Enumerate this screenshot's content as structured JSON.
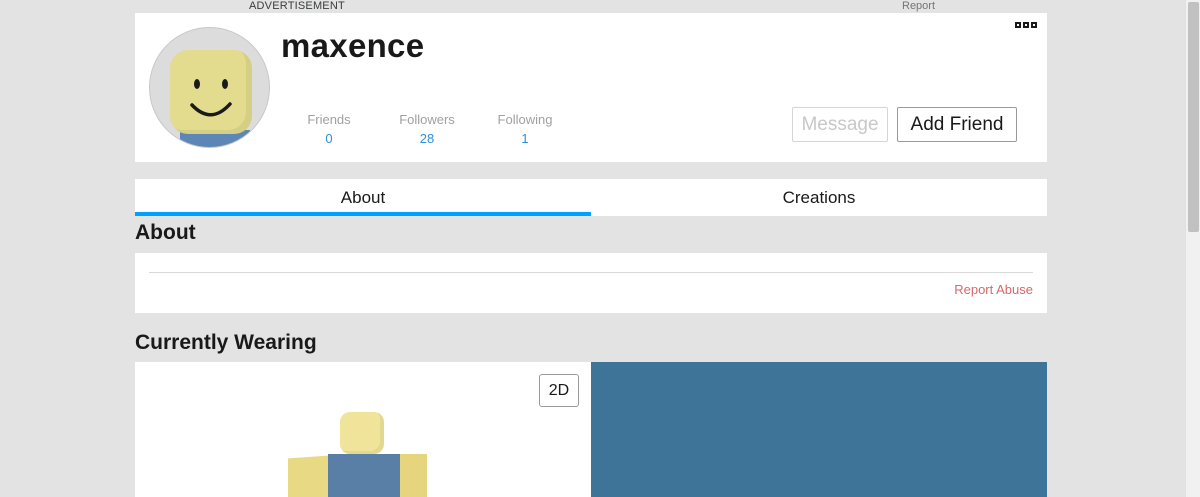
{
  "top_bar": {
    "ad_label": "ADVERTISEMENT",
    "report_label": "Report"
  },
  "profile": {
    "username": "maxence",
    "stats": {
      "friends": {
        "label": "Friends",
        "value": "0"
      },
      "followers": {
        "label": "Followers",
        "value": "28"
      },
      "following": {
        "label": "Following",
        "value": "1"
      }
    },
    "buttons": {
      "message": "Message",
      "add_friend": "Add Friend"
    }
  },
  "tabs": [
    {
      "label": "About",
      "active": true
    },
    {
      "label": "Creations",
      "active": false
    }
  ],
  "about": {
    "title": "About",
    "report_abuse": "Report Abuse"
  },
  "currently_wearing": {
    "title": "Currently Wearing",
    "view_toggle": "2D"
  },
  "colors": {
    "accent": "#00a2ff",
    "link": "#2f8fd9",
    "report": "#d86868",
    "background": "#e3e3e3",
    "outfit_panel": "#3d7498"
  }
}
